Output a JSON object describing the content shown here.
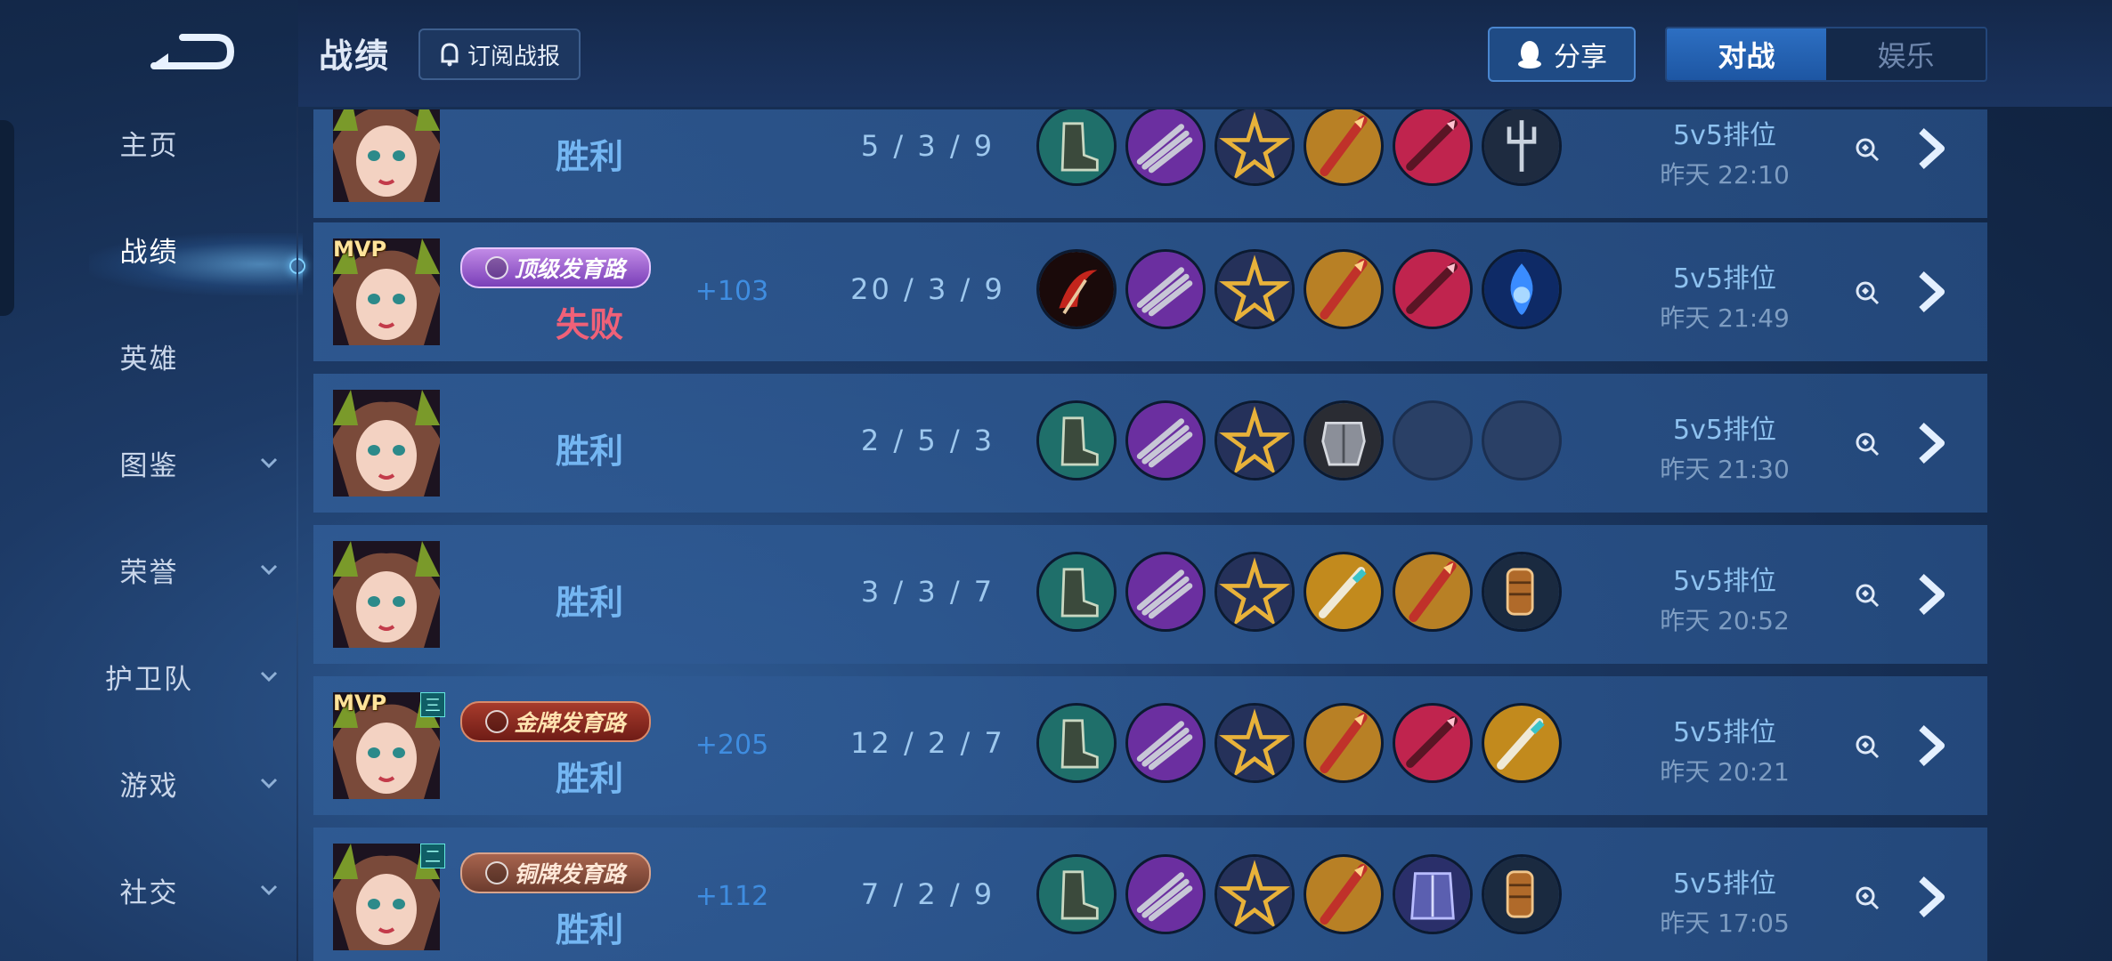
{
  "header": {
    "title": "战绩",
    "subscribe_label": "订阅战报",
    "share_label": "分享",
    "tabs": [
      {
        "label": "对战",
        "active": true
      },
      {
        "label": "娱乐",
        "active": false
      }
    ]
  },
  "sidebar": {
    "items": [
      {
        "label": "主页",
        "expandable": false,
        "active": false
      },
      {
        "label": "战绩",
        "expandable": false,
        "active": true
      },
      {
        "label": "英雄",
        "expandable": false,
        "active": false
      },
      {
        "label": "图鉴",
        "expandable": true,
        "active": false
      },
      {
        "label": "荣誉",
        "expandable": true,
        "active": false
      },
      {
        "label": "护卫队",
        "expandable": true,
        "active": false
      },
      {
        "label": "游戏",
        "expandable": true,
        "active": false
      },
      {
        "label": "社交",
        "expandable": true,
        "active": false
      }
    ]
  },
  "colors": {
    "win": "#74b6f2",
    "loss": "#f06178",
    "accent": "#2d6fc2"
  },
  "matches": [
    {
      "mvp": "",
      "rank_badge": "",
      "lane_badge": "",
      "lane_style": "",
      "result": "胜利",
      "result_type": "win",
      "points": "",
      "kda": "5 / 3 / 9",
      "items": [
        "boots-icon",
        "claw-blade-icon",
        "golden-star-icon",
        "red-spear-icon",
        "crimson-blade-icon",
        "dark-trident-icon"
      ],
      "mode": "5v5排位",
      "time": "昨天 22:10"
    },
    {
      "mvp": "MVP",
      "rank_badge": "",
      "lane_badge": "顶级发育路",
      "lane_style": "purple",
      "result": "失败",
      "result_type": "loss",
      "points": "+103",
      "kda": "20 / 3 / 9",
      "items": [
        "crimson-sickle-icon",
        "claw-blade-icon",
        "golden-star-icon",
        "red-spear-icon",
        "crimson-blade-icon",
        "blue-flame-icon"
      ],
      "mode": "5v5排位",
      "time": "昨天 21:49"
    },
    {
      "mvp": "",
      "rank_badge": "",
      "lane_badge": "",
      "lane_style": "",
      "result": "胜利",
      "result_type": "win",
      "points": "",
      "kda": "2 / 5 / 3",
      "items": [
        "boots-icon",
        "claw-blade-icon",
        "golden-star-icon",
        "armor-icon",
        "empty-slot",
        "empty-slot"
      ],
      "mode": "5v5排位",
      "time": "昨天 21:30"
    },
    {
      "mvp": "",
      "rank_badge": "",
      "lane_badge": "",
      "lane_style": "",
      "result": "胜利",
      "result_type": "win",
      "points": "",
      "kda": "3 / 3 / 7",
      "items": [
        "boots-icon",
        "claw-blade-icon",
        "golden-star-icon",
        "golden-sword-icon",
        "red-spear-icon",
        "gauntlet-icon"
      ],
      "mode": "5v5排位",
      "time": "昨天 20:52"
    },
    {
      "mvp": "MVP",
      "rank_badge": "三",
      "lane_badge": "金牌发育路",
      "lane_style": "gold",
      "result": "胜利",
      "result_type": "win",
      "points": "+205",
      "kda": "12 / 2 / 7",
      "items": [
        "boots-icon",
        "claw-blade-icon",
        "golden-star-icon",
        "red-spear-icon",
        "crimson-blade-icon",
        "golden-sword-icon"
      ],
      "mode": "5v5排位",
      "time": "昨天 20:21"
    },
    {
      "mvp": "",
      "rank_badge": "二",
      "lane_badge": "铜牌发育路",
      "lane_style": "bronze",
      "result": "胜利",
      "result_type": "win",
      "points": "+112",
      "kda": "7 / 2 / 9",
      "items": [
        "boots-icon",
        "claw-blade-icon",
        "golden-star-icon",
        "red-spear-icon",
        "purple-armor-icon",
        "gauntlet-icon"
      ],
      "mode": "5v5排位",
      "time": "昨天 17:05"
    }
  ]
}
